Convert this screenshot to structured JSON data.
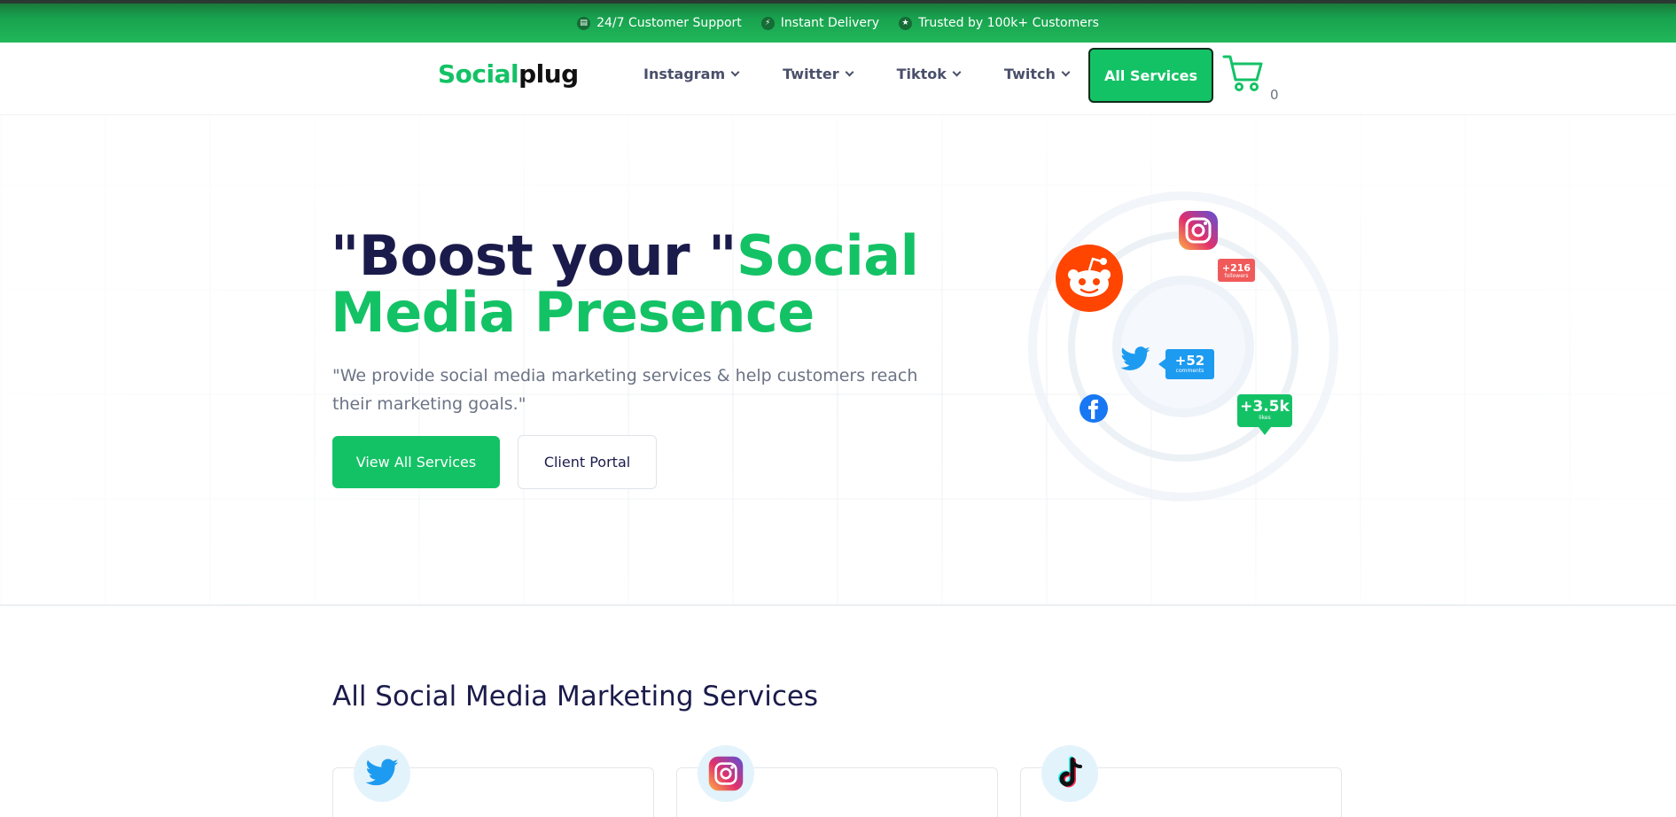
{
  "topbar": {
    "items": [
      {
        "label": "24/7 Customer Support",
        "icon": "chat-icon"
      },
      {
        "label": "Instant Delivery",
        "icon": "bolt-icon"
      },
      {
        "label": "Trusted by 100k+ Customers",
        "icon": "star-icon"
      }
    ]
  },
  "header": {
    "logo_part1": "Social",
    "logo_part2": "plug",
    "nav": [
      {
        "label": "Instagram"
      },
      {
        "label": "Twitter"
      },
      {
        "label": "Tiktok"
      },
      {
        "label": "Twitch"
      }
    ],
    "all_services_label": "All Services",
    "cart_count": "0"
  },
  "hero": {
    "title_dark": "\"Boost your \"",
    "title_green": "Social Media Presence",
    "subtitle": "\"We provide social media marketing services & help customers reach their marketing goals.\"",
    "primary_button": "View All Services",
    "secondary_button": "Client Portal",
    "badges": {
      "followers_value": "+216",
      "followers_label": "followers",
      "comments_value": "+52",
      "comments_label": "comments",
      "likes_value": "+3.5k",
      "likes_label": "likes"
    }
  },
  "services": {
    "title": "All Social Media Marketing Services",
    "cards": [
      {
        "icon": "twitter-icon"
      },
      {
        "icon": "instagram-icon"
      },
      {
        "icon": "tiktok-icon"
      }
    ]
  },
  "colors": {
    "brand_green": "#14c266",
    "navy": "#1b1b4b",
    "reddit": "#ff4500",
    "twitter": "#1d9bf0",
    "facebook": "#1877f2",
    "followers_badge": "#f05a5a"
  }
}
